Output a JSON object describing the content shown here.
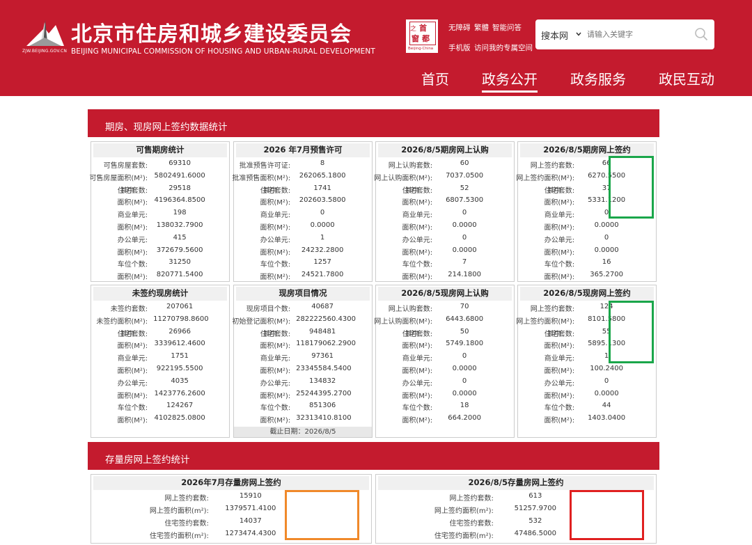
{
  "header": {
    "title": "北京市住房和城乡建设委员会",
    "subtitle": "BEIJING MUNICIPAL COMMISSION OF HOUSING AND URBAN-RURAL DEVELOPMENT",
    "logo_url_text": "ZJW.BEIJING.GOV.CN",
    "seal": {
      "c1": "首",
      "c2": "之",
      "c3": "窗",
      "c4": "都",
      "c5": "Beijing·China"
    },
    "links_row1": [
      "无障碍",
      "繁體",
      "智能问答"
    ],
    "links_row2": [
      "手机版",
      "访问我的专属空间"
    ],
    "search": {
      "scope": "搜本网",
      "placeholder": "请输入关键字"
    },
    "nav": [
      "首页",
      "政务公开",
      "政务服务",
      "政民互动"
    ],
    "brand_color": "#c41b2e"
  },
  "section1": {
    "title": "期房、现房网上签约数据统计"
  },
  "panels": [
    {
      "title": "可售期房统计",
      "rows": [
        {
          "prefix": "",
          "label": "可售房屋套数:",
          "value": "69310"
        },
        {
          "prefix": "",
          "label": "可售房屋面积(M²):",
          "value": "5802491.6000"
        },
        {
          "prefix": "其中",
          "label": "住宅套数:",
          "value": "29518"
        },
        {
          "prefix": "",
          "label": "面积(M²):",
          "value": "4196364.8500"
        },
        {
          "prefix": "",
          "label": "商业单元:",
          "value": "198"
        },
        {
          "prefix": "",
          "label": "面积(M²):",
          "value": "138032.7900"
        },
        {
          "prefix": "",
          "label": "办公单元:",
          "value": "415"
        },
        {
          "prefix": "",
          "label": "面积(M²):",
          "value": "372679.5600"
        },
        {
          "prefix": "",
          "label": "车位个数:",
          "value": "31250"
        },
        {
          "prefix": "",
          "label": "面积(M²):",
          "value": "820771.5400"
        }
      ]
    },
    {
      "title": "2026 年7月预售许可",
      "rows": [
        {
          "prefix": "",
          "label": "批准预售许可证:",
          "value": "8"
        },
        {
          "prefix": "",
          "label": "批准预售面积(M²):",
          "value": "262065.1800"
        },
        {
          "prefix": "其中",
          "label": "住宅套数:",
          "value": "1741"
        },
        {
          "prefix": "",
          "label": "面积(M²):",
          "value": "202603.5800"
        },
        {
          "prefix": "",
          "label": "商业单元:",
          "value": "0"
        },
        {
          "prefix": "",
          "label": "面积(M²):",
          "value": "0.0000"
        },
        {
          "prefix": "",
          "label": "办公单元:",
          "value": "1"
        },
        {
          "prefix": "",
          "label": "面积(M²):",
          "value": "24232.2800"
        },
        {
          "prefix": "",
          "label": "车位个数:",
          "value": "1257"
        },
        {
          "prefix": "",
          "label": "面积(M²):",
          "value": "24521.7800"
        }
      ]
    },
    {
      "title": "2026/8/5期房网上认购",
      "rows": [
        {
          "prefix": "",
          "label": "网上认购套数:",
          "value": "60"
        },
        {
          "prefix": "",
          "label": "网上认购面积(M²):",
          "value": "7037.0500"
        },
        {
          "prefix": "其中",
          "label": "住宅套数:",
          "value": "52"
        },
        {
          "prefix": "",
          "label": "面积(M²):",
          "value": "6807.5300"
        },
        {
          "prefix": "",
          "label": "商业单元:",
          "value": "0"
        },
        {
          "prefix": "",
          "label": "面积(M²):",
          "value": "0.0000"
        },
        {
          "prefix": "",
          "label": "办公单元:",
          "value": "0"
        },
        {
          "prefix": "",
          "label": "面积(M²):",
          "value": "0.0000"
        },
        {
          "prefix": "",
          "label": "车位个数:",
          "value": "7"
        },
        {
          "prefix": "",
          "label": "面积(M²):",
          "value": "214.1800"
        }
      ]
    },
    {
      "title": "2026/8/5期房网上签约",
      "rows": [
        {
          "prefix": "",
          "label": "网上签约套数:",
          "value": "66"
        },
        {
          "prefix": "",
          "label": "网上签约面积(M²):",
          "value": "6270.5500"
        },
        {
          "prefix": "其中",
          "label": "住宅套数:",
          "value": "37"
        },
        {
          "prefix": "",
          "label": "面积(M²):",
          "value": "5331.1200"
        },
        {
          "prefix": "",
          "label": "商业单元:",
          "value": "0"
        },
        {
          "prefix": "",
          "label": "面积(M²):",
          "value": "0.0000"
        },
        {
          "prefix": "",
          "label": "办公单元:",
          "value": "0"
        },
        {
          "prefix": "",
          "label": "面积(M²):",
          "value": "0.0000"
        },
        {
          "prefix": "",
          "label": "车位个数:",
          "value": "16"
        },
        {
          "prefix": "",
          "label": "面积(M²):",
          "value": "365.2700"
        }
      ]
    },
    {
      "title": "未签约现房统计",
      "rows": [
        {
          "prefix": "",
          "label": "未签约套数:",
          "value": "207061"
        },
        {
          "prefix": "",
          "label": "未签约面积(M²):",
          "value": "11270798.8600"
        },
        {
          "prefix": "其中",
          "label": "住宅套数:",
          "value": "26966"
        },
        {
          "prefix": "",
          "label": "面积(M²):",
          "value": "3339612.4600"
        },
        {
          "prefix": "",
          "label": "商业单元:",
          "value": "1751"
        },
        {
          "prefix": "",
          "label": "面积(M²):",
          "value": "922195.5500"
        },
        {
          "prefix": "",
          "label": "办公单元:",
          "value": "4035"
        },
        {
          "prefix": "",
          "label": "面积(M²):",
          "value": "1423776.2600"
        },
        {
          "prefix": "",
          "label": "车位个数:",
          "value": "124267"
        },
        {
          "prefix": "",
          "label": "面积(M²):",
          "value": "4102825.0800"
        }
      ]
    },
    {
      "title": "现房项目情况",
      "rows": [
        {
          "prefix": "",
          "label": "现房项目个数:",
          "value": "40687"
        },
        {
          "prefix": "",
          "label": "初始登记面积(M²):",
          "value": "282222560.4300"
        },
        {
          "prefix": "其中",
          "label": "住宅套数:",
          "value": "948481"
        },
        {
          "prefix": "",
          "label": "面积(M²):",
          "value": "118179062.2900"
        },
        {
          "prefix": "",
          "label": "商业单元:",
          "value": "97361"
        },
        {
          "prefix": "",
          "label": "面积(M²):",
          "value": "23345584.5400"
        },
        {
          "prefix": "",
          "label": "办公单元:",
          "value": "134832"
        },
        {
          "prefix": "",
          "label": "面积(M²):",
          "value": "25244395.2700"
        },
        {
          "prefix": "",
          "label": "车位个数:",
          "value": "851306"
        },
        {
          "prefix": "",
          "label": "面积(M²):",
          "value": "32313410.8100"
        }
      ],
      "footer": "截止日期：2026/8/5"
    },
    {
      "title": "2026/8/5现房网上认购",
      "rows": [
        {
          "prefix": "",
          "label": "网上认购套数:",
          "value": "70"
        },
        {
          "prefix": "",
          "label": "网上认购面积(M²):",
          "value": "6443.6800"
        },
        {
          "prefix": "其中",
          "label": "住宅套数:",
          "value": "50"
        },
        {
          "prefix": "",
          "label": "面积(M²):",
          "value": "5749.1800"
        },
        {
          "prefix": "",
          "label": "商业单元:",
          "value": "0"
        },
        {
          "prefix": "",
          "label": "面积(M²):",
          "value": "0.0000"
        },
        {
          "prefix": "",
          "label": "办公单元:",
          "value": "0"
        },
        {
          "prefix": "",
          "label": "面积(M²):",
          "value": "0.0000"
        },
        {
          "prefix": "",
          "label": "车位个数:",
          "value": "18"
        },
        {
          "prefix": "",
          "label": "面积(M²):",
          "value": "664.2000"
        }
      ]
    },
    {
      "title": "2026/8/5现房网上签约",
      "rows": [
        {
          "prefix": "",
          "label": "网上签约套数:",
          "value": "124"
        },
        {
          "prefix": "",
          "label": "网上签约面积(M²):",
          "value": "8101.5800"
        },
        {
          "prefix": "其中",
          "label": "住宅套数:",
          "value": "55"
        },
        {
          "prefix": "",
          "label": "面积(M²):",
          "value": "5895.1300"
        },
        {
          "prefix": "",
          "label": "商业单元:",
          "value": "1"
        },
        {
          "prefix": "",
          "label": "面积(M²):",
          "value": "100.2400"
        },
        {
          "prefix": "",
          "label": "办公单元:",
          "value": "0"
        },
        {
          "prefix": "",
          "label": "面积(M²):",
          "value": "0.0000"
        },
        {
          "prefix": "",
          "label": "车位个数:",
          "value": "44"
        },
        {
          "prefix": "",
          "label": "面积(M²):",
          "value": "1403.0400"
        }
      ]
    }
  ],
  "section2": {
    "title": "存量房网上签约统计"
  },
  "stock_panels": [
    {
      "title": "2026年7月存量房网上签约",
      "rows": [
        {
          "label": "网上签约套数:",
          "value": "15910"
        },
        {
          "label": "网上签约面积(m²):",
          "value": "1379571.4100"
        },
        {
          "label": "住宅签约套数:",
          "value": "14037"
        },
        {
          "label": "住宅签约面积(m²):",
          "value": "1273474.4300"
        }
      ]
    },
    {
      "title": "2026/8/5存量房网上签约",
      "rows": [
        {
          "label": "网上签约套数:",
          "value": "613"
        },
        {
          "label": "网上签约面积(m²):",
          "value": "51257.9700"
        },
        {
          "label": "住宅签约套数:",
          "value": "532"
        },
        {
          "label": "住宅签约面积(m²):",
          "value": "47486.5000"
        }
      ]
    }
  ],
  "highlight_colors": {
    "green": "#1aa64a",
    "orange": "#f0892a",
    "red": "#e02020"
  }
}
